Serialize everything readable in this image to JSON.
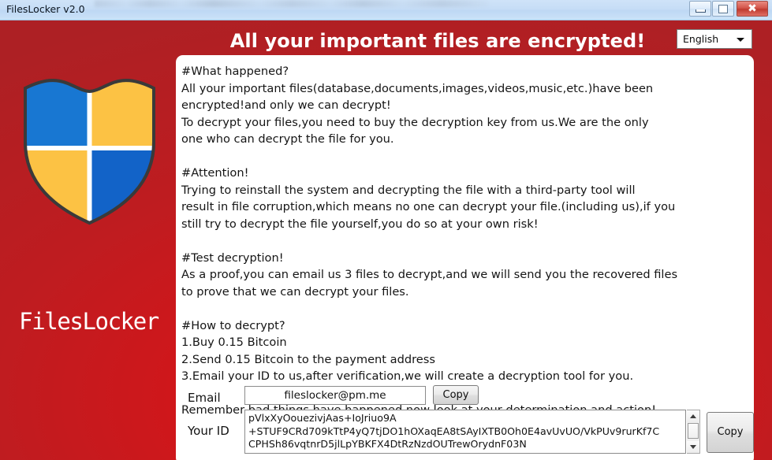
{
  "window": {
    "title": "FilesLocker v2.0",
    "minimize_tooltip": "Minimize",
    "maximize_tooltip": "Maximize",
    "close_glyph": "✖"
  },
  "header": {
    "title": "All your important files are encrypted!",
    "language_selected": "English"
  },
  "brand": {
    "name": "FilesLocker",
    "shield_colors": {
      "top_left": "#1877d2",
      "top_right": "#fcc244",
      "bottom_left": "#fcc244",
      "bottom_right": "#1263c8",
      "outline": "#3a3a3a",
      "divider": "#ffffff"
    }
  },
  "theme": {
    "background_red": "#cf1a1e",
    "panel_white": "#ffffff",
    "header_text": "#ffffff",
    "titlebar_blue": "#c6ddf6"
  },
  "note": {
    "body": "#What happened?\nAll your important files(database,documents,images,videos,music,etc.)have been\nencrypted!and only we can decrypt!\nTo decrypt your files,you need to buy the decryption key from us.We are the only\none who can decrypt the file for you.\n\n#Attention!\nTrying to reinstall the system and decrypting the file with a third-party tool will\nresult in file corruption,which means no one can decrypt your file.(including us),if you\nstill try to decrypt the file yourself,you do so at your own risk!\n\n#Test decryption!\nAs a proof,you can email us 3 files to decrypt,and we will send you the recovered files\nto prove that we can decrypt your files.\n\n#How to decrypt?\n1.Buy 0.15 Bitcoin\n2.Send 0.15 Bitcoin to the payment address\n3.Email your ID to us,after verification,we will create a decryption tool for you.\n\nRemember,bad things have happened,now look at your determination and action!"
  },
  "email_field": {
    "label": "Email",
    "value": "fileslocker@pm.me",
    "copy_label": "Copy"
  },
  "id_field": {
    "label": "Your ID",
    "value": "pVlxXyOouezivjAas+IoJriuo9A\n+STUF9CRd709kTtP4yQ7tjDO1hOXaqEA8tSAyIXTB0Oh0E4avUvUO/VkPUv9rurKf7C\nCPHSh86vqtnrD5jlLpYBKFX4DtRzNzdOUTrewOrydnF03N",
    "copy_label": "Copy"
  }
}
